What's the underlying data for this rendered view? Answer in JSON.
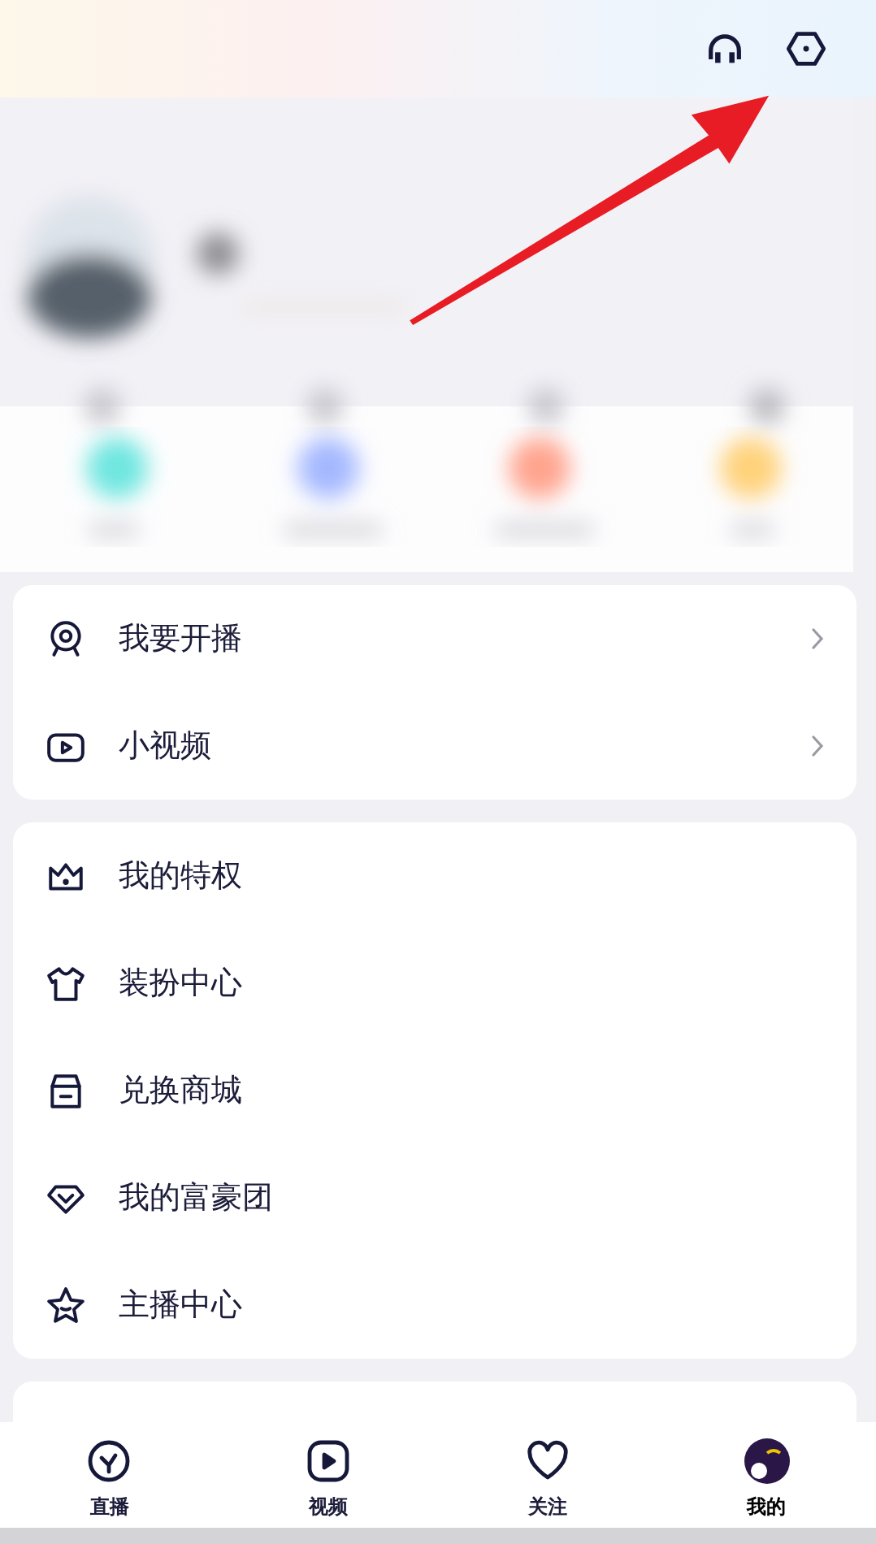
{
  "menu_groups": [
    {
      "items": [
        {
          "label": "我要开播",
          "chevron": true
        },
        {
          "label": "小视频",
          "chevron": true
        }
      ]
    },
    {
      "items": [
        {
          "label": "我的特权",
          "chevron": false
        },
        {
          "label": "装扮中心",
          "chevron": false
        },
        {
          "label": "兑换商城",
          "chevron": false
        },
        {
          "label": "我的富豪团",
          "chevron": false
        },
        {
          "label": "主播中心",
          "chevron": false
        }
      ]
    }
  ],
  "tab_bar": [
    {
      "label": "直播",
      "selected": false
    },
    {
      "label": "视频",
      "selected": false
    },
    {
      "label": "关注",
      "selected": false
    },
    {
      "label": "我的",
      "selected": true
    }
  ]
}
